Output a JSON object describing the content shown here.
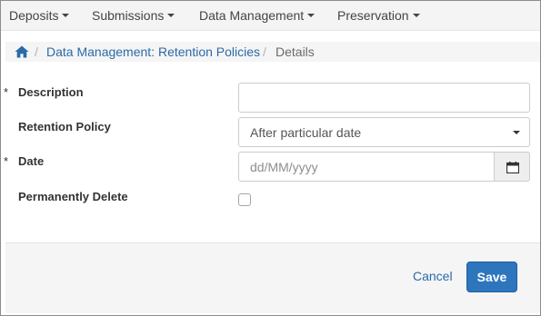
{
  "nav": {
    "items": [
      {
        "label": "Deposits"
      },
      {
        "label": "Submissions"
      },
      {
        "label": "Data Management"
      },
      {
        "label": "Preservation"
      }
    ]
  },
  "breadcrumb": {
    "separator": "/",
    "link": "Data Management: Retention Policies",
    "current": "Details"
  },
  "form": {
    "required_marker": "*",
    "description": {
      "label": "Description",
      "value": ""
    },
    "retention_policy": {
      "label": "Retention Policy",
      "selected": "After particular date"
    },
    "date": {
      "label": "Date",
      "placeholder": "dd/MM/yyyy",
      "value": ""
    },
    "permanently_delete": {
      "label": "Permanently Delete",
      "checked": false
    }
  },
  "footer": {
    "cancel_label": "Cancel",
    "save_label": "Save"
  },
  "colors": {
    "link": "#2a6aa8",
    "primary_button": "#2d76be"
  }
}
